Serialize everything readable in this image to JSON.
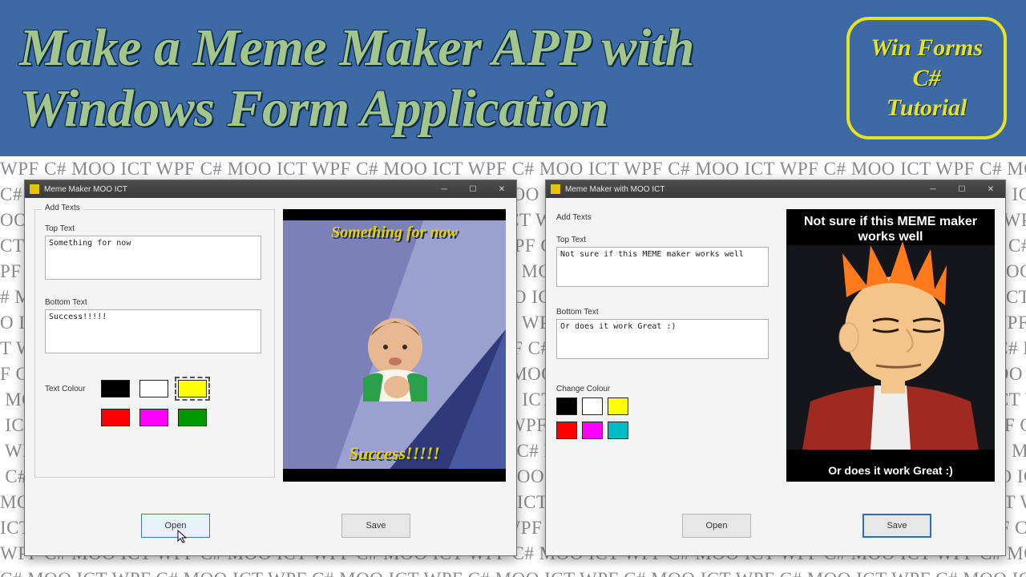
{
  "bg_pattern": "WPF C# MOO ICT ",
  "hero": {
    "title": "Make a Meme Maker APP with\nWindows Form Application",
    "badge_line1": "Win Forms",
    "badge_line2": "C#",
    "badge_line3": "Tutorial"
  },
  "w1": {
    "title": "Meme Maker MOO ICT",
    "group_label": "Add Texts",
    "top_label": "Top Text",
    "top_value": "Something for now",
    "bottom_label": "Bottom Text",
    "bottom_value": "Success!!!!!",
    "color_label": "Text Colour",
    "open_label": "Open",
    "save_label": "Save",
    "meme_top": "Something for now",
    "meme_bottom": "Success!!!!!"
  },
  "w2": {
    "title": "Meme Maker with MOO ICT",
    "group_label": "Add Texts",
    "top_label": "Top Text",
    "top_value": "Not sure if this MEME maker works well",
    "bottom_label": "Bottom Text",
    "bottom_value": "Or does it work Great :)",
    "color_label": "Change Colour",
    "open_label": "Open",
    "save_label": "Save",
    "meme_top": "Not sure if this MEME maker works well",
    "meme_bottom": "Or does it work Great :)"
  },
  "colors": {
    "black": "#000000",
    "white": "#ffffff",
    "yellow": "#ffff00",
    "red": "#ff0000",
    "magenta": "#ff00ff",
    "green": "#009900",
    "cyan": "#00bcc4"
  }
}
